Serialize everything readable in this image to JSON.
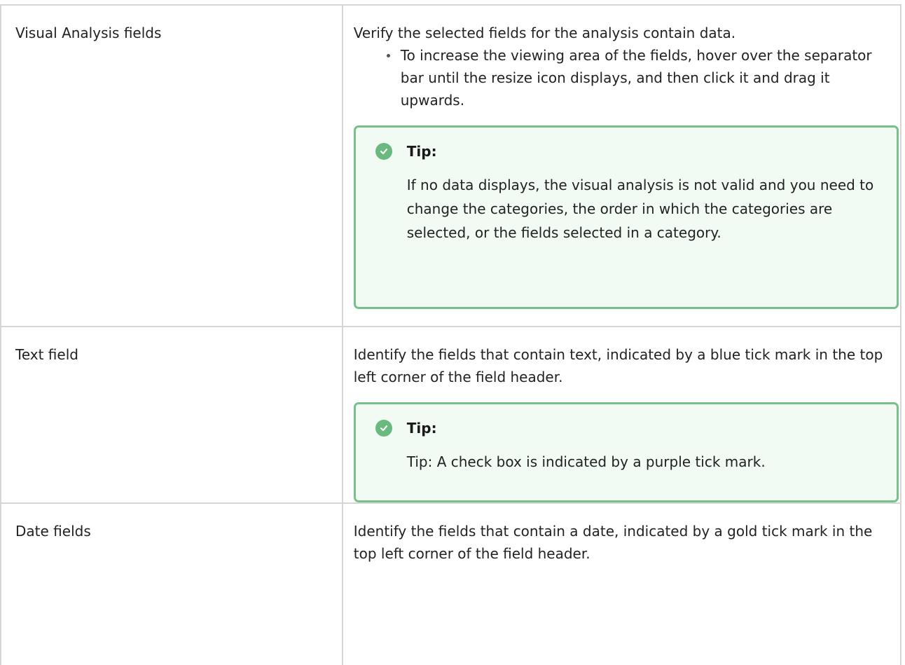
{
  "rows": [
    {
      "field": "Visual Analysis fields",
      "description": "Verify the selected fields for the analysis contain data.",
      "bullets": [
        "To increase the viewing area of the fields, hover over the separator bar until the resize icon displays, and then click it and drag it upwards."
      ],
      "tip": {
        "label": "Tip:",
        "text": "If no data displays, the visual analysis is not valid and you need to change the categories, the order in which the categories are selected, or the fields selected in a category."
      }
    },
    {
      "field": "Text field",
      "description": "Identify the fields that contain text, indicated by a blue tick mark in the top left corner of the field header.",
      "tip": {
        "label": "Tip:",
        "text": "Tip: A check box is indicated by a purple tick mark."
      }
    },
    {
      "field": "Date fields",
      "description": "Identify the fields that contain a date, indicated by a gold tick mark in the top left corner of the field header."
    }
  ],
  "icons": {
    "tip": "check-circle-icon"
  },
  "colors": {
    "tip_border": "#78c08a",
    "tip_background": "#f2faf4",
    "tip_icon": "#6ab97e",
    "table_border": "#d6d6d6"
  }
}
